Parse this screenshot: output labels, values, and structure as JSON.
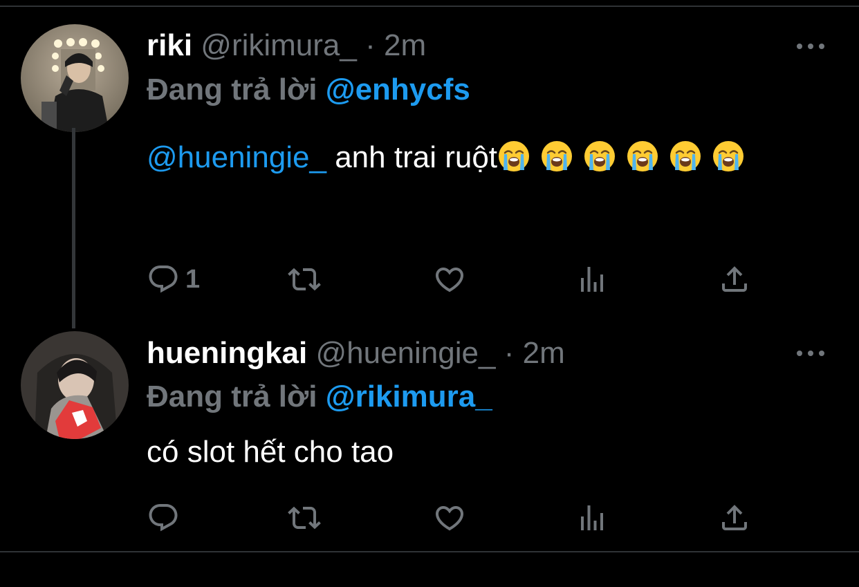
{
  "tweets": [
    {
      "display_name": "riki",
      "handle": "@rikimura_",
      "separator": "·",
      "time": "2m",
      "replying_prefix": "Đang trả lời",
      "replying_to": "@enhycfs",
      "body_mention": "@hueningie_",
      "body_text": " anh trai ruột",
      "emoji_count": 6,
      "reply_count": "1"
    },
    {
      "display_name": "hueningkai",
      "handle": "@hueningie_",
      "separator": "·",
      "time": "2m",
      "replying_prefix": "Đang trả lời",
      "replying_to": "@rikimura_",
      "body_text": "có slot hết cho tao",
      "reply_count": ""
    }
  ],
  "icons": {
    "reply": "reply-icon",
    "retweet": "retweet-icon",
    "like": "heart-icon",
    "views": "views-icon",
    "share": "share-icon",
    "more": "more-icon",
    "emoji": "loudly-crying-face-emoji"
  },
  "colors": {
    "background": "#000000",
    "text": "#ffffff",
    "muted": "#71767b",
    "accent": "#1d9bf0",
    "divider": "#2f3336"
  }
}
